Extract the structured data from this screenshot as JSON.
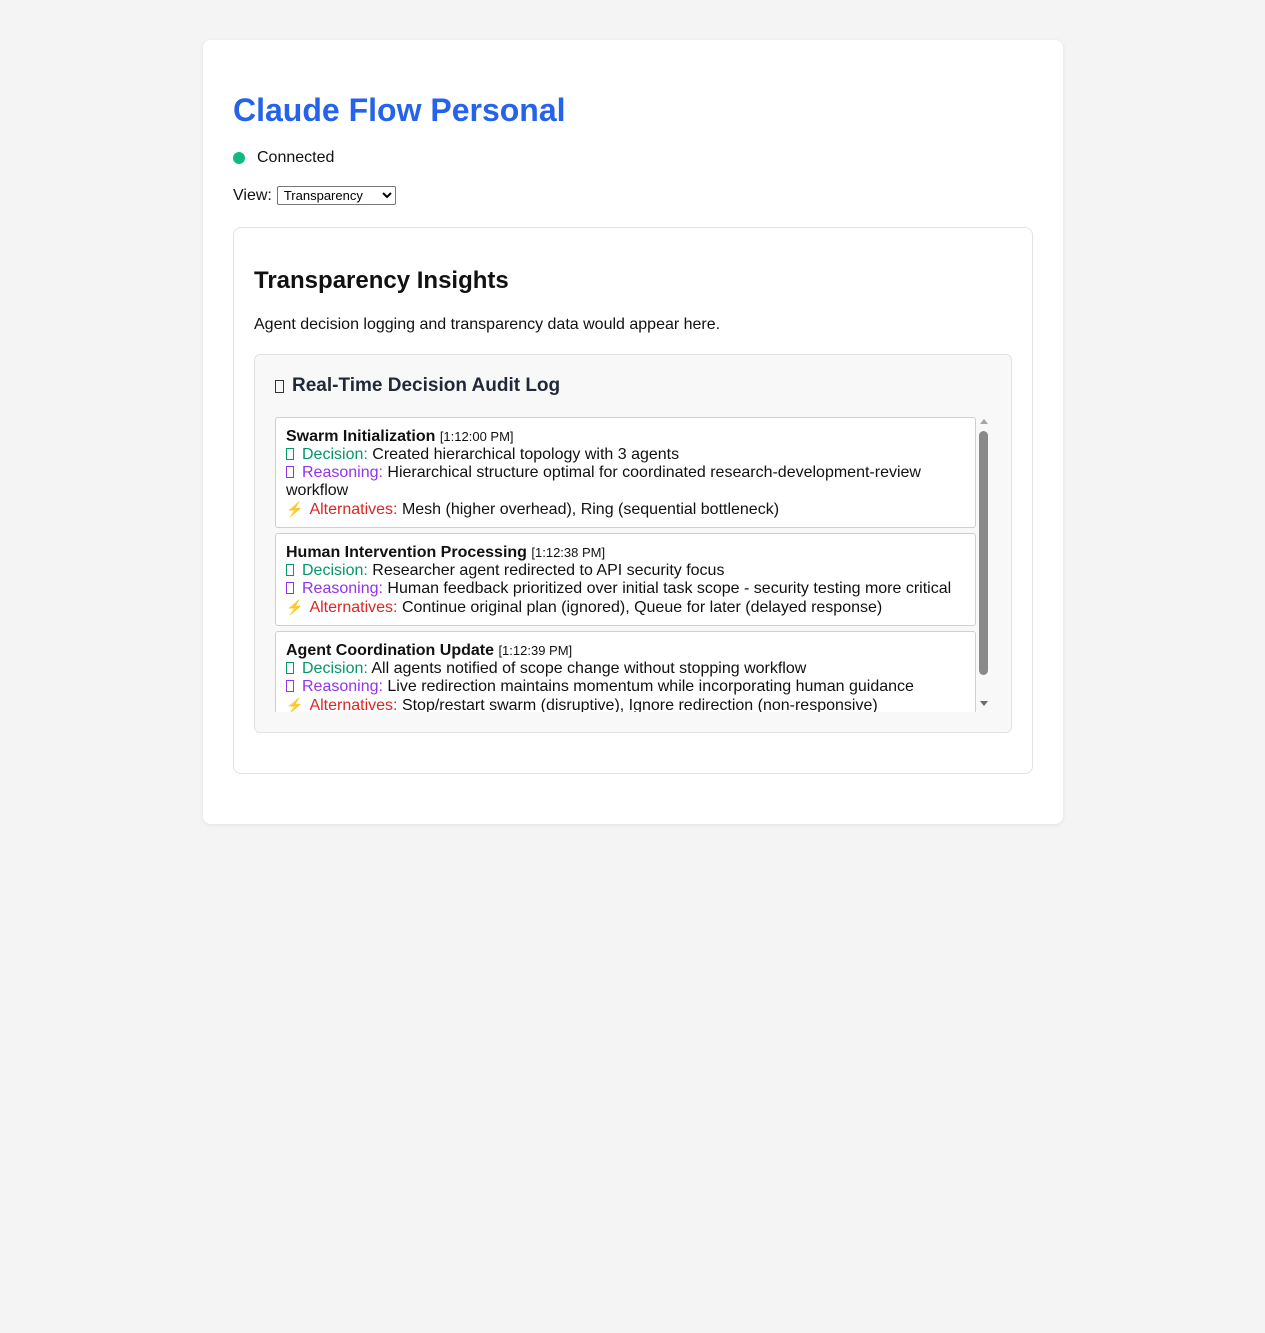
{
  "app": {
    "title": "Claude Flow Personal"
  },
  "status": {
    "text": "Connected",
    "color": "#10b981"
  },
  "view": {
    "label": "View:",
    "selected": "Transparency"
  },
  "panel": {
    "title": "Transparency Insights",
    "description": "Agent decision logging and transparency data would appear here."
  },
  "audit": {
    "icon": "clipboard-icon",
    "title": "Real-Time Decision Audit Log",
    "entries": [
      {
        "title": "Swarm Initialization",
        "time": "[1:12:00 PM]",
        "decision_label": "Decision:",
        "decision": "Created hierarchical topology with 3 agents",
        "reasoning_label": "Reasoning:",
        "reasoning": "Hierarchical structure optimal for coordinated research-development-review workflow",
        "alternatives_label": "Alternatives:",
        "alternatives": "Mesh (higher overhead), Ring (sequential bottleneck)"
      },
      {
        "title": "Human Intervention Processing",
        "time": "[1:12:38 PM]",
        "decision_label": "Decision:",
        "decision": "Researcher agent redirected to API security focus",
        "reasoning_label": "Reasoning:",
        "reasoning": "Human feedback prioritized over initial task scope - security testing more critical",
        "alternatives_label": "Alternatives:",
        "alternatives": "Continue original plan (ignored), Queue for later (delayed response)"
      },
      {
        "title": "Agent Coordination Update",
        "time": "[1:12:39 PM]",
        "decision_label": "Decision:",
        "decision": "All agents notified of scope change without stopping workflow",
        "reasoning_label": "Reasoning:",
        "reasoning": "Live redirection maintains momentum while incorporating human guidance",
        "alternatives_label": "Alternatives:",
        "alternatives": "Stop/restart swarm (disruptive), Ignore redirection (non-responsive)"
      }
    ]
  },
  "colors": {
    "title": "#2563eb",
    "decision": "#059669",
    "reasoning": "#9333ea",
    "alternatives": "#dc2626"
  }
}
